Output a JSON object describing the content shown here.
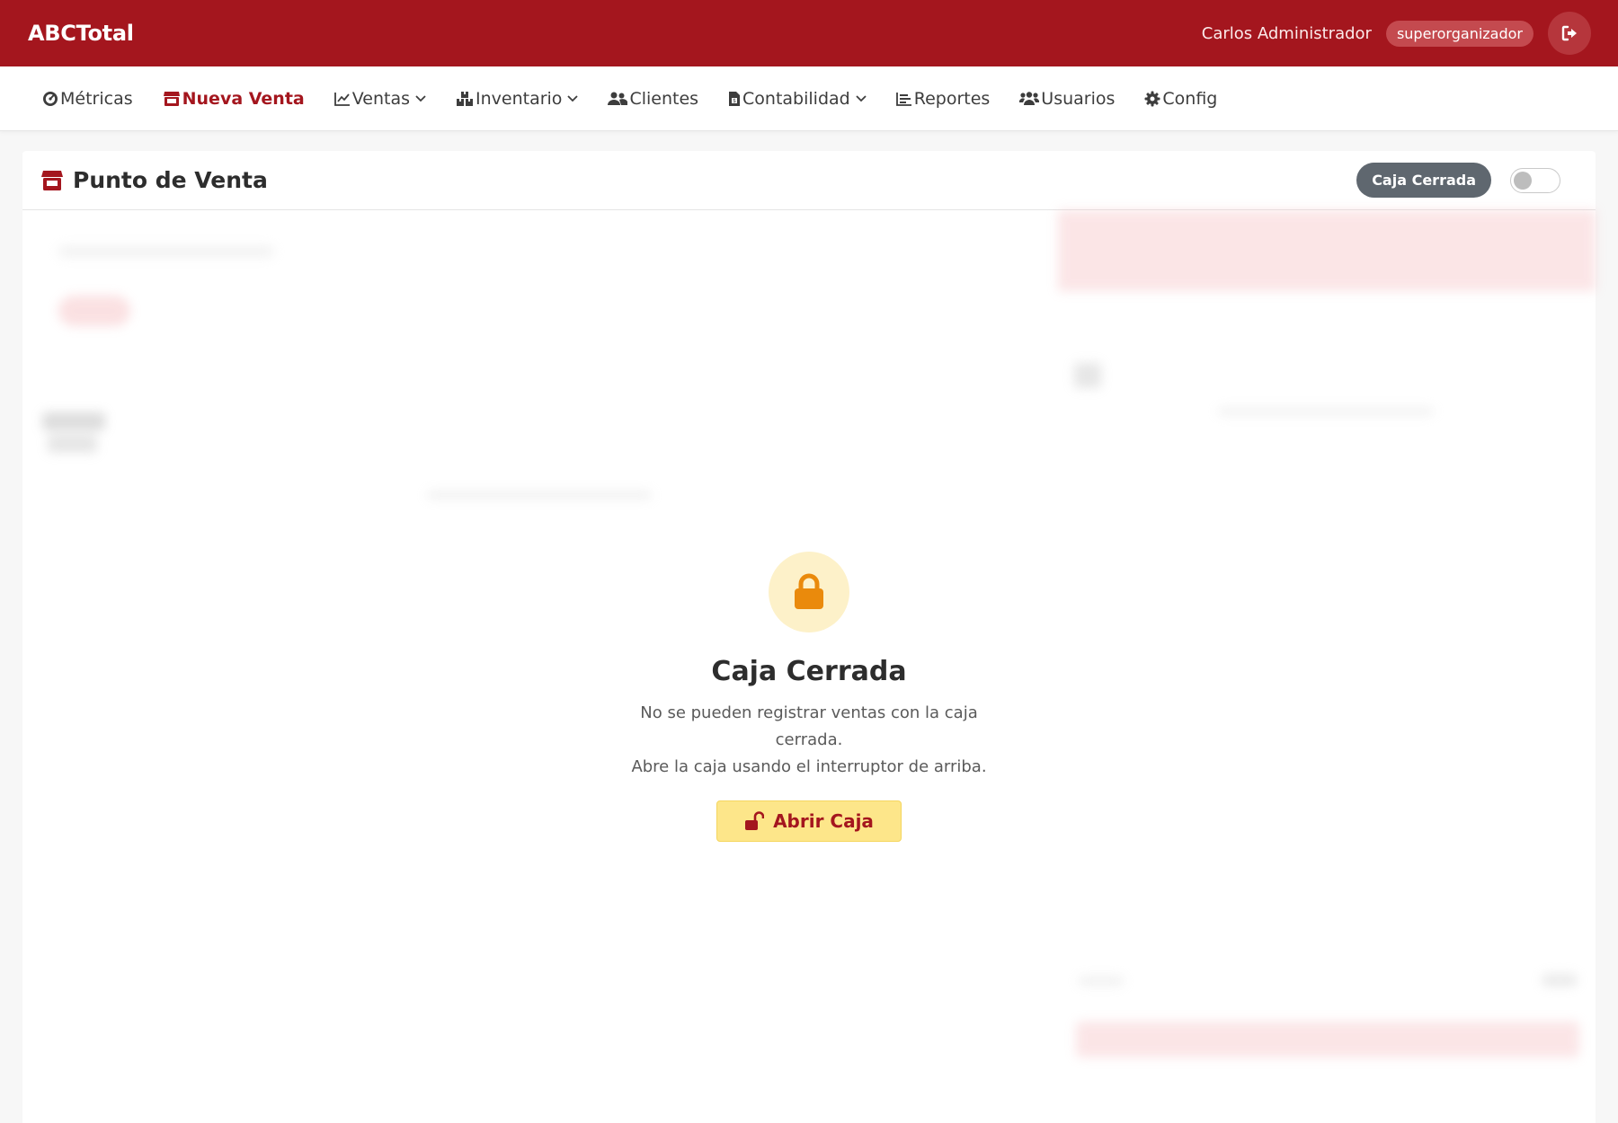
{
  "topbar": {
    "brand": "ABCTotal",
    "user_name": "Carlos Administrador",
    "role": "superorganizador",
    "logout_icon": "sign-out-icon"
  },
  "nav": {
    "items": [
      {
        "label": "Métricas",
        "icon": "gauge-icon",
        "dropdown": false
      },
      {
        "label": "Nueva Venta",
        "icon": "store-icon",
        "dropdown": false,
        "active": true
      },
      {
        "label": "Ventas",
        "icon": "chart-line-icon",
        "dropdown": true
      },
      {
        "label": "Inventario",
        "icon": "boxes-icon",
        "dropdown": true
      },
      {
        "label": "Clientes",
        "icon": "users-icon",
        "dropdown": false
      },
      {
        "label": "Contabilidad",
        "icon": "file-invoice-icon",
        "dropdown": true
      },
      {
        "label": "Reportes",
        "icon": "list-icon",
        "dropdown": false
      },
      {
        "label": "Usuarios",
        "icon": "users-cog-icon",
        "dropdown": false
      },
      {
        "label": "Config",
        "icon": "gear-icon",
        "dropdown": false
      }
    ]
  },
  "header": {
    "title": "Punto de Venta",
    "status": "Caja Cerrada",
    "toggle_on": false
  },
  "lock": {
    "title": "Caja Cerrada",
    "message_line1": "No se pueden registrar ventas con la caja cerrada.",
    "message_line2": "Abre la caja usando el interruptor de arriba.",
    "button_label": "Abrir Caja"
  },
  "colors": {
    "brand": "#a4161e",
    "lock_bg": "#fdf1c9",
    "lock_icon": "#ea8a0c",
    "button_bg": "#fde68a",
    "status_pill": "#5f676f"
  }
}
